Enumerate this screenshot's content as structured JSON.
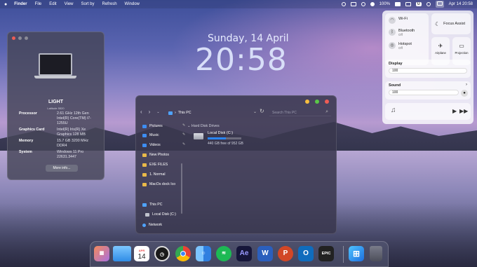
{
  "menubar": {
    "apple_icon": "apple-icon",
    "items": [
      "Finder",
      "File",
      "Edit",
      "View",
      "Sort by",
      "Refresh",
      "Window"
    ],
    "battery": "100%",
    "datetime": "Apr 14 20:58"
  },
  "lockscreen": {
    "date": "Sunday, 14 April",
    "time": "20:58"
  },
  "about": {
    "name": "LIGHT",
    "model": "Latitude 5520",
    "specs": [
      {
        "key": "Processor",
        "value": "2.61 GHz 12th Gen Intel(R) Core(TM) i7-1255U"
      },
      {
        "key": "Graphics Card",
        "value": "Intel(R) Iris(R) Xe Graphics 128 MB"
      },
      {
        "key": "Memory",
        "value": "15.7 GB 3200 MHz DDR4"
      },
      {
        "key": "System",
        "value": "Windows 11 Pro 22631.3447"
      }
    ],
    "more_button": "More info..."
  },
  "explorer": {
    "path": "This PC",
    "search_placeholder": "Search This PC",
    "sidebar": [
      "Pictures",
      "Music",
      "Videos",
      "New Photos",
      "EXE FILES",
      "1. Normal",
      "MacOs dock Ico",
      "This PC",
      "Local Disk (C:)",
      "Network"
    ],
    "section": "Hard Disk Drives",
    "disk": {
      "name": "Local Disk (C:)",
      "free": "440 GB free of 952 GB",
      "used_fraction": 0.54
    }
  },
  "control_center": {
    "wifi": {
      "label": "Wi-Fi"
    },
    "bluetooth": {
      "label": "Bluetooth",
      "status": "Off"
    },
    "hotspot": {
      "label": "Hotspot",
      "status": "Off"
    },
    "focus": "Focus Assist",
    "airplane": "Airplane",
    "projection": "Projection",
    "display": {
      "label": "Display",
      "value": "100"
    },
    "sound": {
      "label": "Sound",
      "value": "100"
    }
  },
  "dock": {
    "apps": [
      "Launchpad",
      "Finder",
      "Calendar",
      "Clock",
      "Chrome",
      "Finder Face",
      "Spotify",
      "After Effects",
      "Word",
      "PowerPoint",
      "Outlook",
      "Epic Games",
      "Windows",
      "Trash"
    ],
    "calendar_month": "APR",
    "calendar_day": "14",
    "ae_label": "Ae",
    "word_label": "W",
    "ppt_label": "P",
    "outlook_label": "O",
    "epic_label": "EPIC"
  },
  "colors": {
    "accent": "#2a85f5",
    "close": "#ee5d55",
    "minimize": "#f6be3f",
    "maximize": "#5ac748"
  }
}
